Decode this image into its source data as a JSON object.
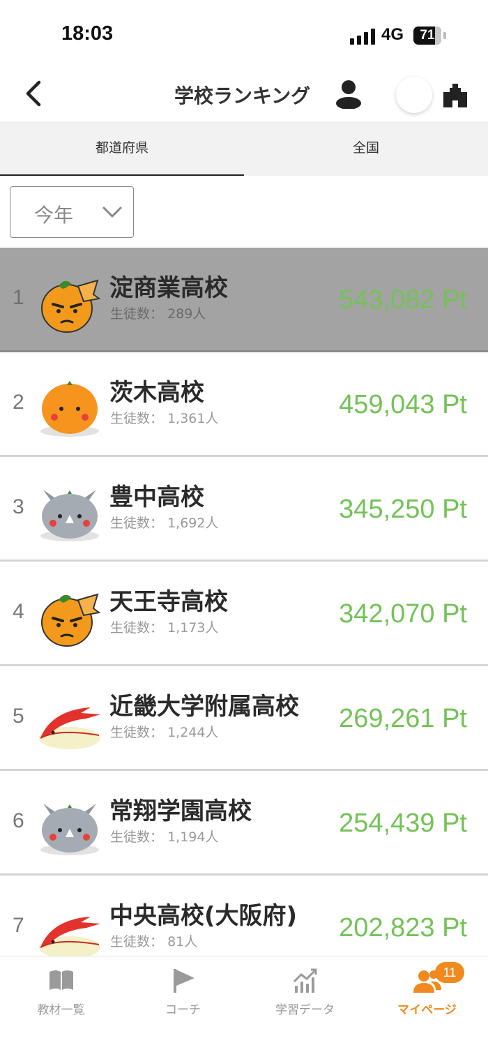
{
  "status_bar": {
    "time": "18:03",
    "network": "4G",
    "battery": "71"
  },
  "nav": {
    "title": "学校ランキング"
  },
  "tabs": [
    {
      "label": "都道府県",
      "active": true
    },
    {
      "label": "全国",
      "active": false
    }
  ],
  "filter": {
    "selected": "今年"
  },
  "colors": {
    "points": "#73c256",
    "accent": "#f08a1e",
    "highlight_row": "#a3a3a3"
  },
  "rankings": [
    {
      "rank": "1",
      "name": "淀商業高校",
      "students_label": "生徒数：",
      "students": "289人",
      "points": "543,082 Pt",
      "mascot": "orange-samurai-icon"
    },
    {
      "rank": "2",
      "name": "茨木高校",
      "students_label": "生徒数：",
      "students": "1,361人",
      "points": "459,043 Pt",
      "mascot": "orange-fruit-icon"
    },
    {
      "rank": "3",
      "name": "豊中高校",
      "students_label": "生徒数：",
      "students": "1,692人",
      "points": "345,250 Pt",
      "mascot": "grey-rhino-icon"
    },
    {
      "rank": "4",
      "name": "天王寺高校",
      "students_label": "生徒数：",
      "students": "1,173人",
      "points": "342,070 Pt",
      "mascot": "orange-samurai-icon"
    },
    {
      "rank": "5",
      "name": "近畿大学附属高校",
      "students_label": "生徒数：",
      "students": "1,244人",
      "points": "269,261 Pt",
      "mascot": "red-crest-icon"
    },
    {
      "rank": "6",
      "name": "常翔学園高校",
      "students_label": "生徒数：",
      "students": "1,194人",
      "points": "254,439 Pt",
      "mascot": "grey-rhino-icon"
    },
    {
      "rank": "7",
      "name": "中央高校(大阪府)",
      "students_label": "生徒数：",
      "students": "81人",
      "points": "202,823 Pt",
      "mascot": "red-crest-icon"
    }
  ],
  "bottom_tabs": [
    {
      "label": "教材一覧",
      "icon": "book-icon",
      "active": false
    },
    {
      "label": "コーチ",
      "icon": "flag-icon",
      "active": false
    },
    {
      "label": "学習データ",
      "icon": "chart-icon",
      "active": false
    },
    {
      "label": "マイページ",
      "icon": "users-icon",
      "active": true,
      "badge": "11"
    }
  ]
}
